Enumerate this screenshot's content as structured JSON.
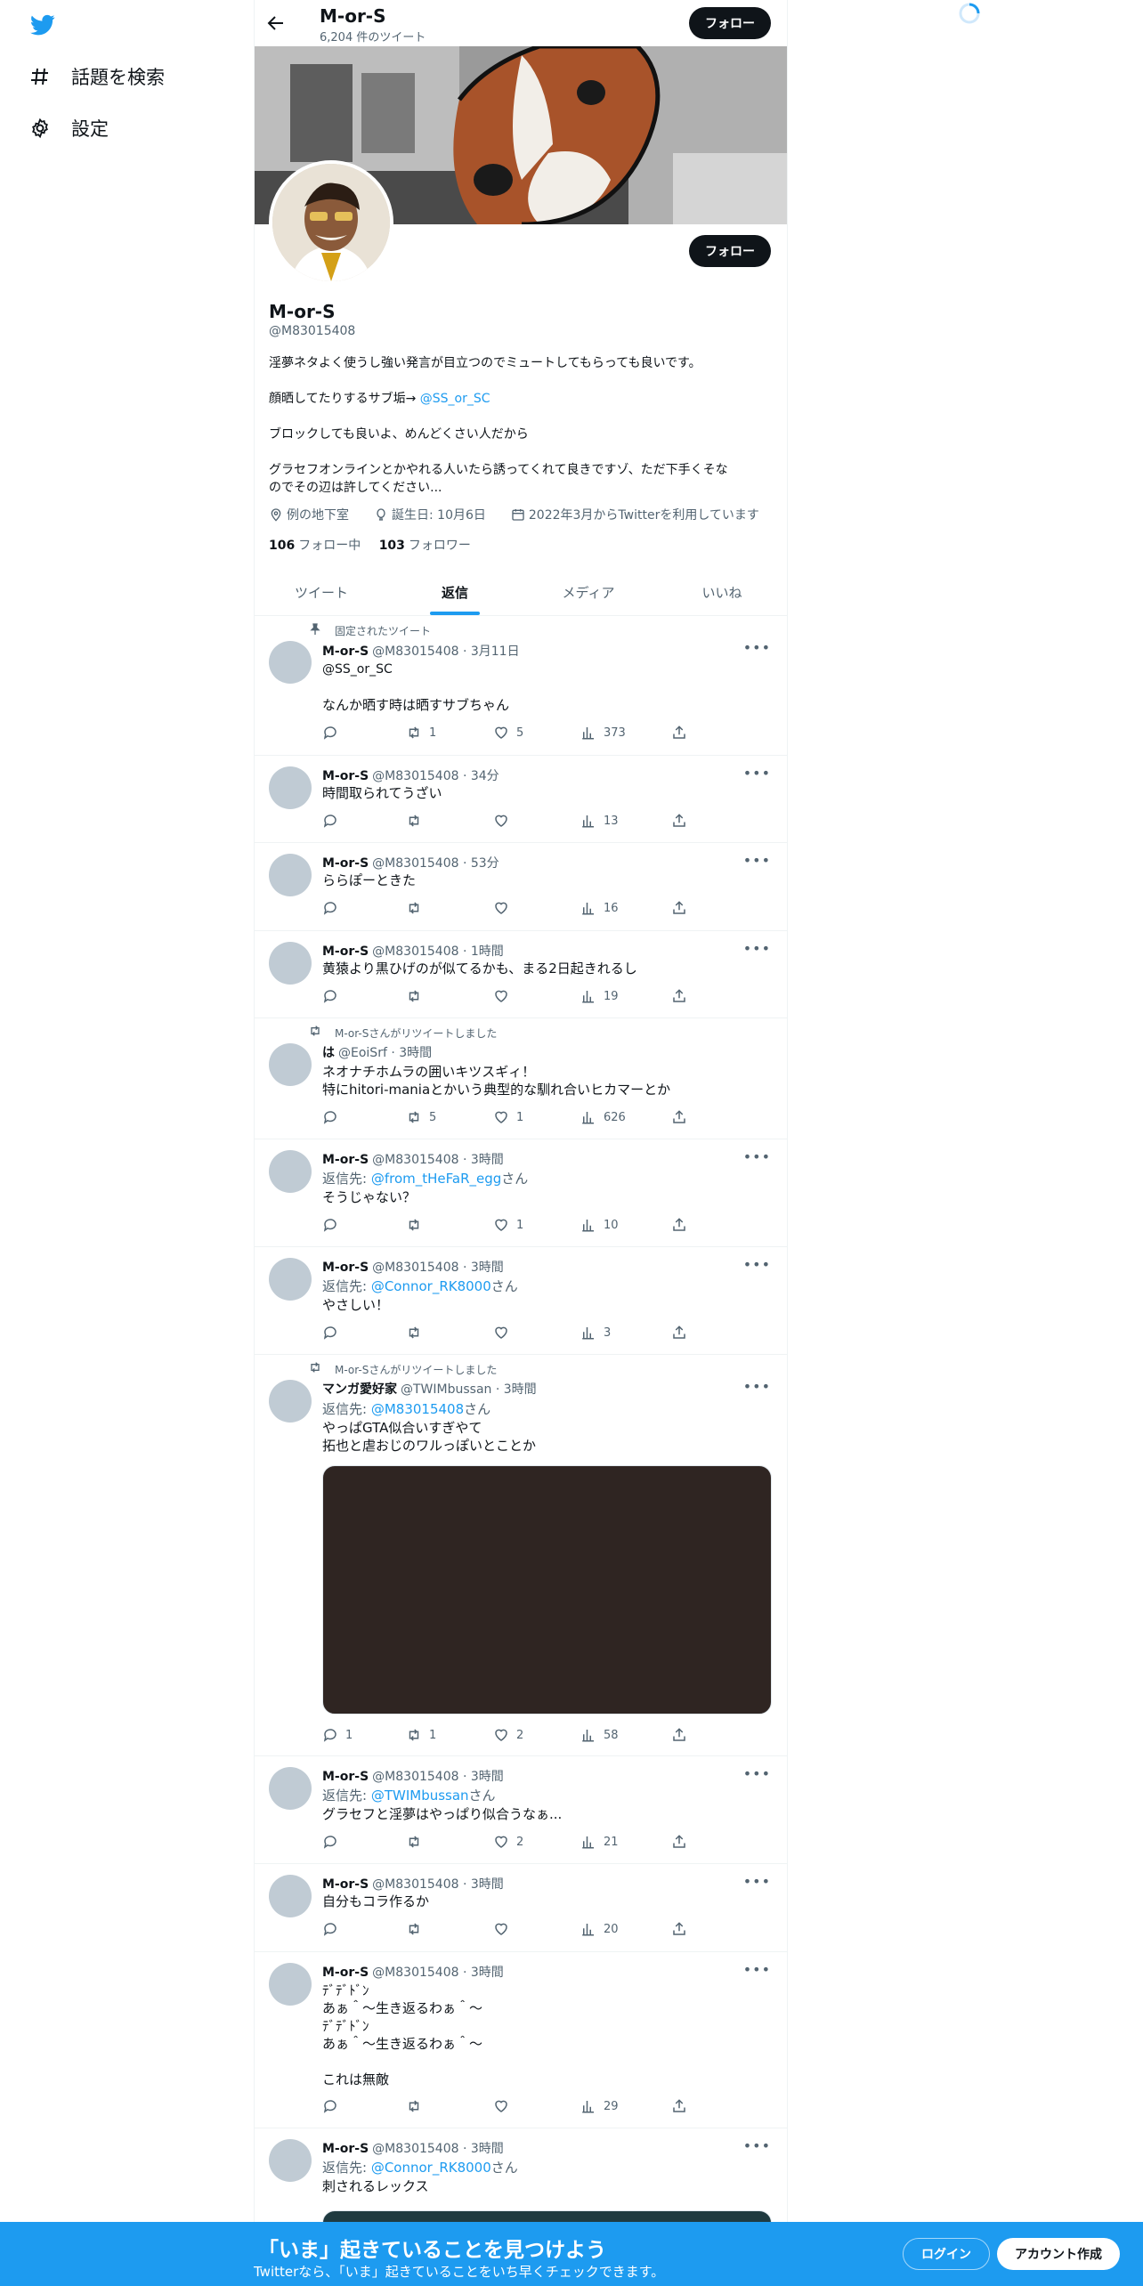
{
  "nav": {
    "items": [
      {
        "label": "話題を検索",
        "icon": "hashtag-icon"
      },
      {
        "label": "設定",
        "icon": "gear-icon"
      }
    ]
  },
  "topbar": {
    "name": "M-or-S",
    "tweet_count": "6,204 件のツイート",
    "follow_label": "フォロー"
  },
  "profile": {
    "name": "M-or-S",
    "handle": "@M83015408",
    "follow_label": "フォロー",
    "bio": {
      "line1": "淫夢ネタよく使うし強い発言が目立つのでミュートしてもらっても良いです。",
      "line2_text": "顔晒してたりするサブ垢→ ",
      "line2_link": "@SS_or_SC",
      "line3": "ブロックしても良いよ、めんどくさい人だから",
      "line4": "グラセフオンラインとかやれる人いたら誘ってくれて良きですゾ、ただ下手くそな",
      "line5": "のでその辺は許してください..."
    },
    "location": "例の地下室",
    "birthday": "誕生日: 10月6日",
    "joined": "2022年3月からTwitterを利用しています",
    "following_count": "106",
    "following_label": "フォロー中",
    "followers_count": "103",
    "followers_label": "フォロワー"
  },
  "tabs": [
    "ツイート",
    "返信",
    "メディア",
    "いいね"
  ],
  "tweets": [
    {
      "pinned": "固定されたツイート",
      "name": "M-or-S",
      "meta": "@M83015408 · 3月11日",
      "mention": "@SS_or_SC",
      "text": "なんか晒す時は晒すサブちゃん",
      "reply": "",
      "retweets": "1",
      "likes": "5",
      "views": "373"
    },
    {
      "name": "M-or-S",
      "meta": "@M83015408 · 34分",
      "text": "時間取られてうざい",
      "views": "13"
    },
    {
      "name": "M-or-S",
      "meta": "@M83015408 · 53分",
      "text": "ららぽーときた",
      "views": "16"
    },
    {
      "name": "M-or-S",
      "meta": "@M83015408 · 1時間",
      "text": "黄猿より黒ひげのが似てるかも、まる2日起きれるし",
      "views": "19"
    },
    {
      "retweeted": "M-or-Sさんがリツイートしました",
      "name": "は",
      "meta": "@EoiSrf · 3時間",
      "text1": "ネオナチホムラの囲いキツスギィ！",
      "text2": "特にhitori-maniaとかいう典型的な馴れ合いヒカマーとか",
      "retweets": "5",
      "likes": "1",
      "views": "626"
    },
    {
      "name": "M-or-S",
      "meta": "@M83015408 · 3時間",
      "reply_prefix": "返信先: ",
      "reply_to": "@from_tHeFaR_egg",
      "reply_suffix": "さん",
      "text": "そうじゃない？",
      "likes": "1",
      "views": "10"
    },
    {
      "name": "M-or-S",
      "meta": "@M83015408 · 3時間",
      "reply_prefix": "返信先: ",
      "reply_to": "@Connor_RK8000",
      "reply_suffix": "さん",
      "text": "やさしい！",
      "views": "3"
    },
    {
      "retweeted": "M-or-Sさんがリツイートしました",
      "name": "マンガ愛好家",
      "meta": "@TWIMbussan · 3時間",
      "reply_prefix": "返信先: ",
      "reply_to": "@M83015408",
      "reply_suffix": "さん",
      "text1": "やっぱGTA似合いすぎやて",
      "text2": "拓也と虐おじのワルっぽいとことか",
      "replies": "1",
      "retweets": "1",
      "likes": "2",
      "views": "58"
    },
    {
      "name": "M-or-S",
      "meta": "@M83015408 · 3時間",
      "reply_prefix": "返信先: ",
      "reply_to": "@TWIMbussan",
      "reply_suffix": "さん",
      "text": "グラセフと淫夢はやっぱり似合うなぁ...",
      "likes": "2",
      "views": "21"
    },
    {
      "name": "M-or-S",
      "meta": "@M83015408 · 3時間",
      "text": "自分もコラ作るか",
      "views": "20"
    },
    {
      "name": "M-or-S",
      "meta": "@M83015408 · 3時間",
      "text1": "ﾃﾞﾃﾞﾄﾞﾝ",
      "text2": "あぁ＾～生き返るわぁ＾～",
      "text3": "ﾃﾞﾃﾞﾄﾞﾝ",
      "text4": "あぁ＾～生き返るわぁ＾～",
      "text5": "これは無敵",
      "views": "29"
    },
    {
      "name": "M-or-S",
      "meta": "@M83015408 · 3時間",
      "reply_prefix": "返信先: ",
      "reply_to": "@Connor_RK8000",
      "reply_suffix": "さん",
      "text": "刺されるレックス"
    }
  ],
  "bottom": {
    "title": "「いま」起きていることを見つけよう",
    "subtitle": "Twitterなら、「いま」起きていることをいち早くチェックできます。",
    "login": "ログイン",
    "signup": "アカウント作成"
  },
  "colors": {
    "accent": "#1d9bf0",
    "text": "#0f1419",
    "muted": "#536471"
  }
}
